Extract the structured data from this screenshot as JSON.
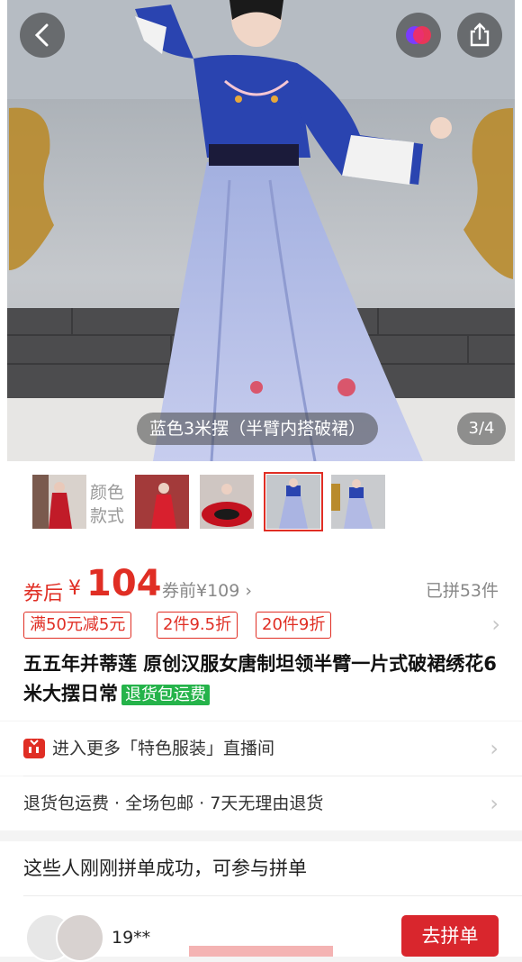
{
  "hero": {
    "caption": "蓝色3米摆（半臂内搭破裙）",
    "counter": "3/4"
  },
  "icons": {
    "back": "back-arrow-icon",
    "app": "app-badge-icon",
    "share": "share-icon",
    "live": "live-tv-icon"
  },
  "thumbs": {
    "label_line1": "颜色",
    "label_line2": "款式",
    "selected_index": 3
  },
  "price": {
    "label": "券后",
    "currency": "¥",
    "value": "104",
    "before": "券前¥109",
    "sold": "已拼53件"
  },
  "tags": [
    "满50元减5元",
    "2件9.5折",
    "20件9折"
  ],
  "title": "五五年并蒂莲 原创汉服女唐制坦领半臂一片式破裙绣花6米大摆日常",
  "badge": "退货包运费",
  "rows": {
    "live_prefix": "进入更多",
    "live_highlight": "「特色服装」",
    "live_suffix": "直播间",
    "service": "退货包运费 · 全场包邮 · 7天无理由退货"
  },
  "group": {
    "title": "这些人刚刚拼单成功，可参与拼单",
    "username": "19**",
    "join_label": "去拼单"
  },
  "colors": {
    "accent": "#e02e24",
    "green": "#25b34a"
  }
}
